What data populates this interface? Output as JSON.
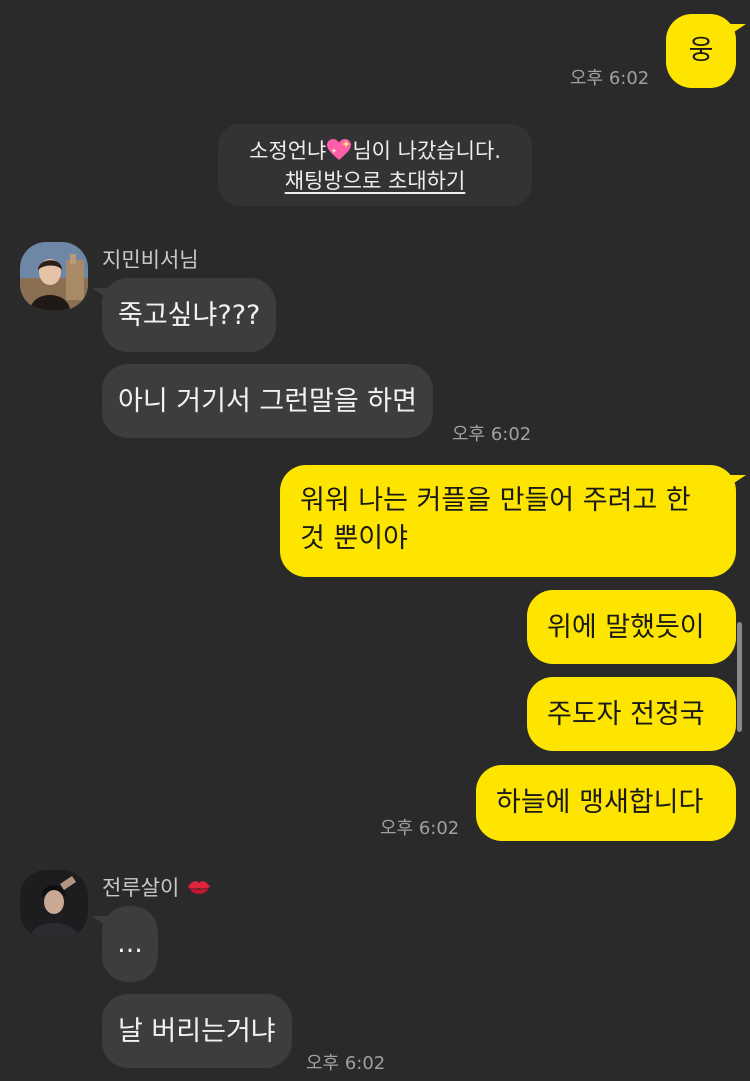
{
  "notice": {
    "line1_prefix": "소정언냐",
    "line1_suffix": "님이 나갔습니다.",
    "emoji": "sparkling-heart-icon",
    "link": "채팅방으로 초대하기"
  },
  "messages": {
    "m1": {
      "text": "웅",
      "time": "오후 6:02"
    },
    "jimin": {
      "name": "지민비서님",
      "msg1": "죽고싶냐???",
      "msg2": "아니 거기서 그런말을 하면",
      "time": "오후 6:02"
    },
    "me2": {
      "msg1_line1": "워워 나는 커플을 만들어 주려고 한",
      "msg1_line2": "것 뿐이야",
      "msg2": "위에 말했듯이",
      "msg3": "주도자 전정국",
      "msg4": "하늘에 맹새합니다",
      "time": "오후 6:02"
    },
    "jungkook": {
      "name": "전루살이",
      "name_icon": "kiss-mark-icon",
      "msg1": "...",
      "msg2": "날 버리는거냐",
      "time": "오후 6:02"
    }
  },
  "colors": {
    "background": "#2a2a2b",
    "my_bubble": "#fee500",
    "their_bubble": "#3d3d3f"
  }
}
